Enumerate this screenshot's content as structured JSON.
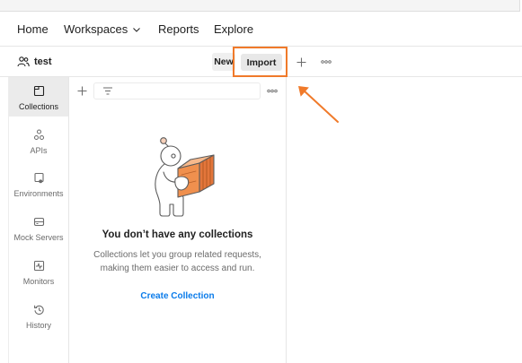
{
  "nav": {
    "items": [
      {
        "label": "Home"
      },
      {
        "label": "Workspaces",
        "icon": "chevron-down-icon"
      },
      {
        "label": "Reports"
      },
      {
        "label": "Explore"
      }
    ]
  },
  "workspace": {
    "icon": "people-icon",
    "name": "test",
    "new_label": "New",
    "import_label": "Import",
    "new_tab_icon": "plus-icon",
    "more_icon": "more-horizontal-icon"
  },
  "sidebar": {
    "items": [
      {
        "label": "Collections",
        "icon": "collections-icon",
        "selected": true
      },
      {
        "label": "APIs",
        "icon": "apis-icon",
        "selected": false
      },
      {
        "label": "Environments",
        "icon": "environments-icon",
        "selected": false
      },
      {
        "label": "Mock Servers",
        "icon": "mock-servers-icon",
        "selected": false
      },
      {
        "label": "Monitors",
        "icon": "monitors-icon",
        "selected": false
      },
      {
        "label": "History",
        "icon": "history-icon",
        "selected": false
      }
    ]
  },
  "collections_panel": {
    "toolbar": {
      "add_icon": "plus-icon",
      "filter_icon": "filter-icon",
      "filter_value": "",
      "more_icon": "more-horizontal-icon"
    },
    "empty_state": {
      "illustration_icon": "person-carrying-box-illustration",
      "title": "You don’t have any collections",
      "description_lines": [
        "Collections let you group related requests,",
        "making them easier to access and run."
      ],
      "create_label": "Create Collection"
    }
  },
  "annotation": {
    "arrow_icon": "arrow-up-left-icon"
  },
  "colors": {
    "text_primary": "#212121",
    "text_secondary": "#6b6b6b",
    "selected_bg": "#ebebeb",
    "accent_link": "#0a7bea",
    "annotation_orange": "#f07a2a",
    "border": "#e6e6e6"
  }
}
